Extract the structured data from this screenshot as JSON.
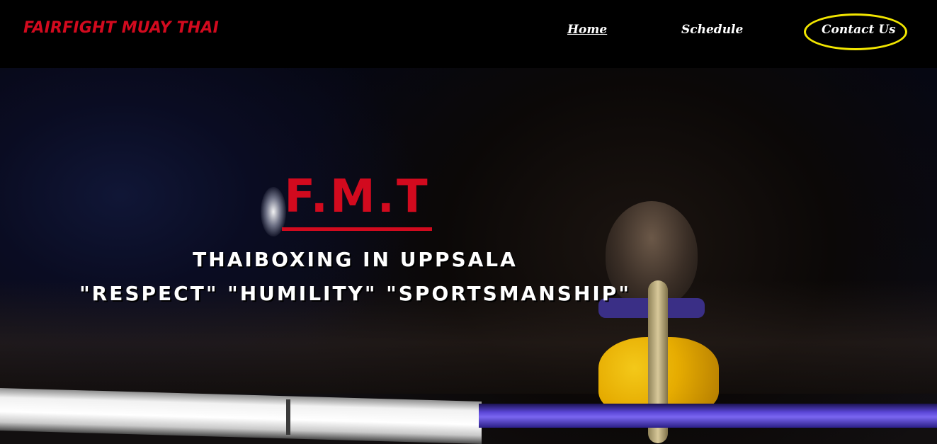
{
  "header": {
    "brand": "FAIRFIGHT MUAY THAI",
    "nav": {
      "home": "Home",
      "schedule": "Schedule",
      "contact": "Contact Us"
    }
  },
  "hero": {
    "title": "F.M.T",
    "tagline_1": "THAIBOXING IN UPPSALA",
    "tagline_2": "\"RESPECT\" \"HUMILITY\" \"SPORTSMANSHIP\""
  },
  "colors": {
    "brand_red": "#d20a1e",
    "highlight_ring": "#f2e600",
    "background": "#000000"
  }
}
